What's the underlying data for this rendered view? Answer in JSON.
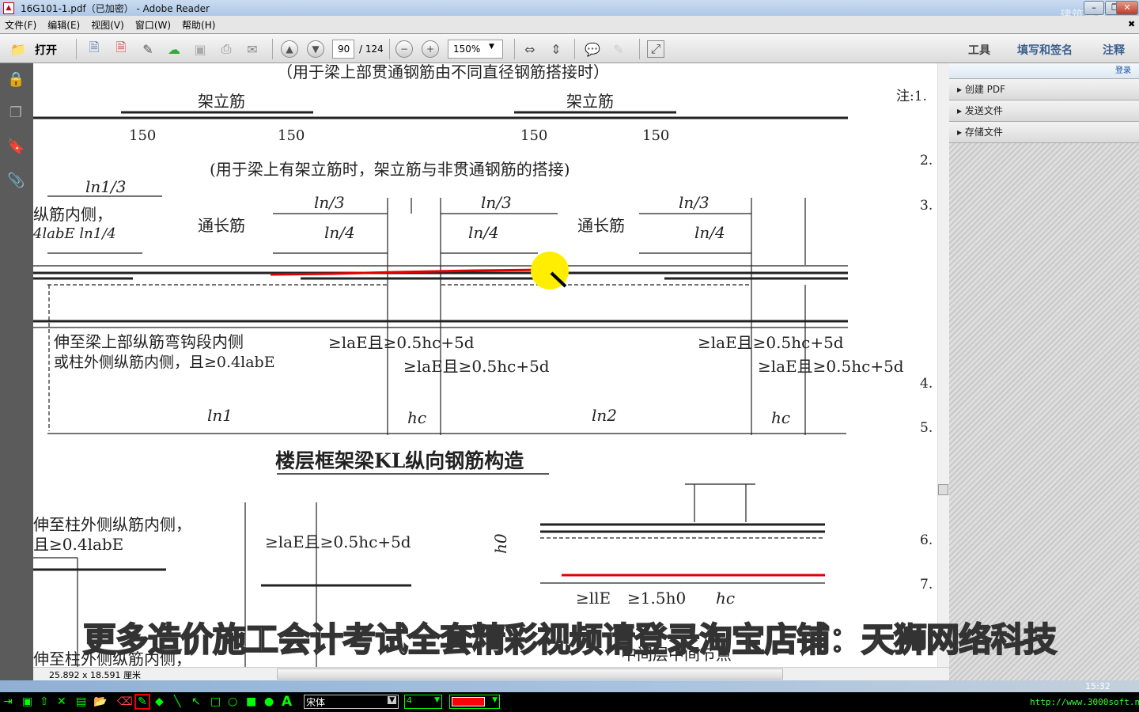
{
  "window": {
    "title": "16G101-1.pdf（已加密） - Adobe Reader",
    "minimize": "–",
    "restore": "❐",
    "close": "✕",
    "logo_text": "建筑课堂"
  },
  "menu": [
    "文件(F)",
    "编辑(E)",
    "视图(V)",
    "窗口(W)",
    "帮助(H)"
  ],
  "toolbar": {
    "open_label": "打开",
    "page_current": "90",
    "page_total": "/ 124",
    "zoom": "150%",
    "tools": "工具",
    "fill_sign": "填写和签名",
    "comment": "注释"
  },
  "right_panel": {
    "login": "登录",
    "items": [
      "创建 PDF",
      "发送文件",
      "存储文件"
    ]
  },
  "status": {
    "page_size": "25.892 x 18.591 厘米"
  },
  "taskbar": {
    "time": "15:32"
  },
  "annotation_bar": {
    "font": "宋体",
    "size": "4",
    "url": "http://www.3000soft.net",
    "pen_color": "#ff0000"
  },
  "watermark": "更多造价施工会计考试全套精彩视频请登录淘宝店铺：天狮网络科技",
  "doc": {
    "caption1": "（用于梁上部贯通钢筋由不同直径钢筋搭接时）",
    "jialijin": "架立筋",
    "dim150": "150",
    "caption2": "(用于梁上有架立筋时，架立筋与非贯通钢筋的搭接)",
    "ln1_3": "ln1/3",
    "zongjin": "纵筋内侧，",
    "labe_ln1_4": "4labE  ln1/4",
    "ln_3": "ln/3",
    "ln_4": "ln/4",
    "tongchangjin": "通长筋",
    "note_a1": "伸至梁上部纵筋弯钩段内侧",
    "note_a2": "或柱外侧纵筋内侧，且≥0.4labE",
    "anchor": "≥laE且≥0.5hc+5d",
    "ln1": "ln1",
    "ln2": "ln2",
    "hc": "hc",
    "heading": "楼层框架梁KL纵向钢筋构造",
    "note_b1": "伸至柱外侧纵筋内侧，",
    "note_b2": "且≥0.4labE",
    "h0": "h0",
    "llE": "≥llE",
    "h15": "≥1.5h0",
    "mid_node": "中间层中间节点",
    "notes": [
      "注:1.",
      "2.",
      "3.",
      "4.",
      "5.",
      "6.",
      "7."
    ]
  }
}
